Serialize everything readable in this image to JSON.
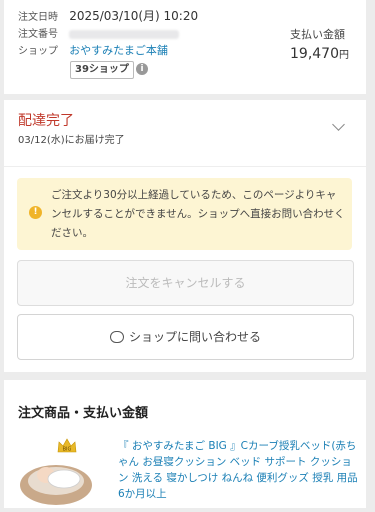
{
  "header": {
    "order_date_label": "注文日時",
    "order_date": "2025/03/10(月) 10:20",
    "order_no_label": "注文番号",
    "shop_label": "ショップ",
    "shop_name": "おやすみたまご本舗",
    "shop_badge": "39ショップ",
    "info_icon": "i",
    "payment_label": "支払い金額",
    "payment_amount": "19,470",
    "payment_unit": "円"
  },
  "status": {
    "title": "配達完了",
    "delivered": "03/12(水)にお届け完了"
  },
  "notice": {
    "icon": "!",
    "text": "ご注文より30分以上経過しているため、このページよりキャンセルすることができません。ショップへ直接お問い合わせください。"
  },
  "buttons": {
    "cancel": "注文をキャンセルする",
    "contact": "ショップに問い合わせる"
  },
  "section": {
    "title": "注文商品・支払い金額"
  },
  "product": {
    "badge": "BIG",
    "title": "『 おやすみたまご BIG 』Cカーブ授乳ベッド(赤ちゃん お昼寝クッション ベッド サポート クッション 洗える 寝かしつけ ねんね 便利グッズ 授乳 用品 6か月以上"
  },
  "colors": {
    "accent_red": "#c0392b",
    "link_blue": "#1a7fb5",
    "notice_bg": "#fdf5d3",
    "warn_yellow": "#f0b429"
  }
}
